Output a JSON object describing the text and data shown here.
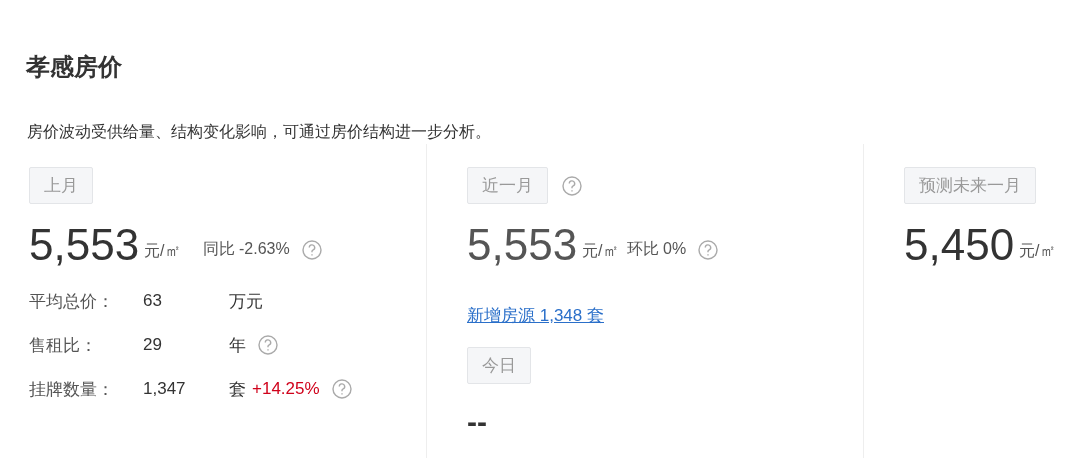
{
  "title": "孝感房价",
  "description": "房价波动受供给量、结构变化影响，可通过房价结构进一步分析。",
  "columns": [
    {
      "tag": "上月",
      "tag_help": false,
      "price": "5,553",
      "unit": "元/㎡",
      "change": "同比 -2.63%",
      "change_help": true,
      "stats": [
        {
          "label": "平均总价：",
          "value": "63",
          "unit": "万元",
          "help": false
        },
        {
          "label": "售租比：",
          "value": "29",
          "unit": "年",
          "help": true
        },
        {
          "label": "挂牌数量：",
          "value": "1,347",
          "unit": "套",
          "trend": "+14.25%",
          "help": true
        }
      ]
    },
    {
      "tag": "近一月",
      "tag_help": true,
      "price": "5,553",
      "unit": "元/㎡",
      "change": "环比 0%",
      "change_help": true,
      "link": "新增房源 1,348 套",
      "today_tag": "今日",
      "today_value": "--"
    },
    {
      "tag": "预测未来一月",
      "tag_help": false,
      "price": "5,450",
      "unit": "元/㎡"
    }
  ]
}
